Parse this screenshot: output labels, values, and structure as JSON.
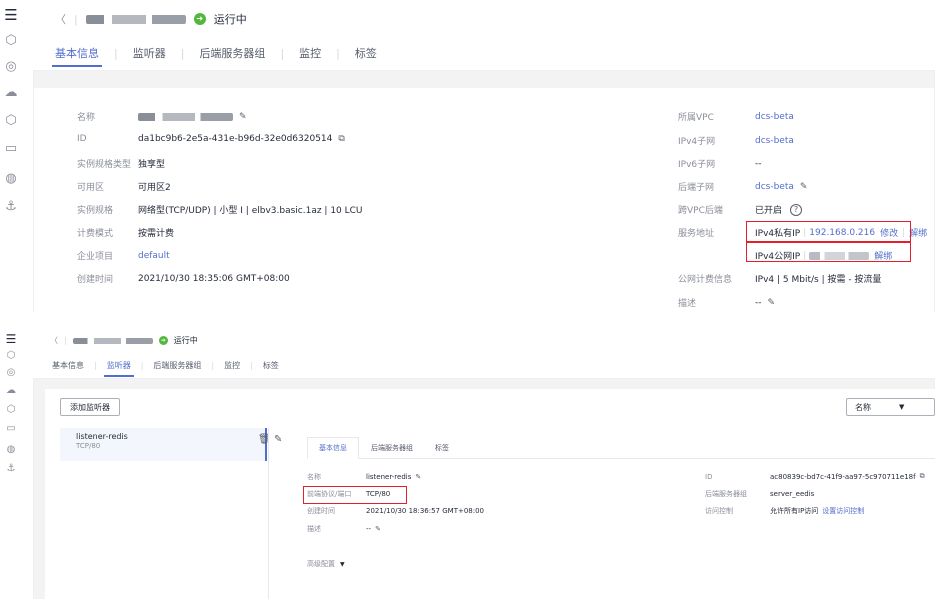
{
  "top": {
    "instance_name_masked": "Ip...masked",
    "status": "运行中",
    "tabs": [
      "基本信息",
      "监听器",
      "后端服务器组",
      "监控",
      "标签"
    ],
    "active_tab": 0,
    "fields_left": [
      {
        "label": "名称",
        "value": "",
        "masked": true,
        "editable": true
      },
      {
        "label": "ID",
        "value": "da1bc9b6-2e5a-431e-b96d-32e0d6320514",
        "copy": true
      },
      {
        "label": "实例规格类型",
        "value": "独享型"
      },
      {
        "label": "可用区",
        "value": "可用区2"
      },
      {
        "label": "实例规格",
        "value": "网络型(TCP/UDP) | 小型 I | elbv3.basic.1az | 10 LCU"
      },
      {
        "label": "计费模式",
        "value": "按需计费"
      },
      {
        "label": "企业项目",
        "value": "default",
        "link": true
      },
      {
        "label": "创建时间",
        "value": "2021/10/30 18:35:06 GMT+08:00"
      }
    ],
    "fields_right": {
      "vpc_label": "所属VPC",
      "vpc_value": "dcs-beta",
      "ipv4_subnet_label": "IPv4子网",
      "ipv4_subnet_value": "dcs-beta",
      "ipv6_subnet_label": "IPv6子网",
      "ipv6_subnet_value": "--",
      "backend_subnet_label": "后端子网",
      "backend_subnet_value": "dcs-beta",
      "cross_vpc_label": "跨VPC后端",
      "cross_vpc_value": "已开启",
      "service_addr_label": "服务地址",
      "private_ip_label": "IPv4私有IP",
      "private_ip_value": "192.168.0.216",
      "modify": "修改",
      "unbind": "解绑",
      "public_ip_label": "IPv4公网IP",
      "public_ip_unbind": "解绑",
      "billing_label": "公网计费信息",
      "billing_value": "IPv4 | 5 Mbit/s | 按需 - 按流量",
      "desc_label": "描述",
      "desc_value": "--"
    }
  },
  "bottom": {
    "instance_name_masked": "elb...masked",
    "status": "运行中",
    "tabs": [
      "基本信息",
      "监听器",
      "后端服务器组",
      "监控",
      "标签"
    ],
    "active_tab": 1,
    "add_listener": "添加监听器",
    "sort_select": "名称",
    "listener": {
      "name": "listener-redis",
      "proto": "TCP/80"
    },
    "sub_tabs": [
      "基本信息",
      "后端服务器组",
      "标签"
    ],
    "fields_left": {
      "name_label": "名称",
      "name_value": "listener-redis",
      "proto_label": "前端协议/端口",
      "proto_value": "TCP/80",
      "created_label": "创建时间",
      "created_value": "2021/10/30 18:36:57 GMT+08:00",
      "desc_label": "描述",
      "desc_value": "--"
    },
    "fields_right": {
      "id_label": "ID",
      "id_value": "ac80839c-bd7c-41f9-aa97-5c970711e18f",
      "group_label": "后端服务器组",
      "group_value": "server_eedis",
      "access_label": "访问控制",
      "access_value": "允许所有IP访问",
      "access_link": "设置访问控制"
    },
    "advanced": "高级配置"
  }
}
